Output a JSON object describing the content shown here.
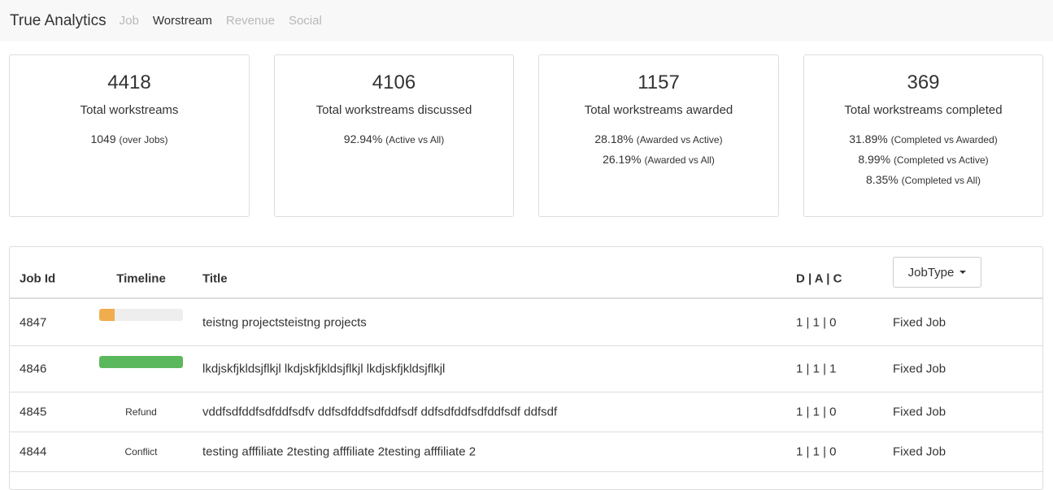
{
  "navbar": {
    "brand": "True Analytics",
    "links": [
      {
        "label": "Job",
        "active": false
      },
      {
        "label": "Worstream",
        "active": true
      },
      {
        "label": "Revenue",
        "active": false
      },
      {
        "label": "Social",
        "active": false
      }
    ]
  },
  "cards": [
    {
      "value": "4418",
      "label": "Total workstreams",
      "stats": [
        {
          "value": "1049",
          "note": "(over Jobs)"
        }
      ]
    },
    {
      "value": "4106",
      "label": "Total workstreams discussed",
      "stats": [
        {
          "value": "92.94%",
          "note": "(Active vs All)"
        }
      ]
    },
    {
      "value": "1157",
      "label": "Total workstreams awarded",
      "stats": [
        {
          "value": "28.18%",
          "note": "(Awarded vs Active)"
        },
        {
          "value": "26.19%",
          "note": "(Awarded vs All)"
        }
      ]
    },
    {
      "value": "369",
      "label": "Total workstreams completed",
      "stats": [
        {
          "value": "31.89%",
          "note": "(Completed vs Awarded)"
        },
        {
          "value": "8.99%",
          "note": "(Completed vs Active)"
        },
        {
          "value": "8.35%",
          "note": "(Completed vs All)"
        }
      ]
    }
  ],
  "table": {
    "headers": {
      "job_id": "Job Id",
      "timeline": "Timeline",
      "title": "Title",
      "dac": "D | A | C",
      "jobtype_button": "JobType"
    },
    "rows": [
      {
        "id": "4847",
        "timeline_progress": 0.18,
        "timeline_color": "#f0ad4e",
        "timeline_text": "",
        "title": "teistng projectsteistng projects",
        "dac": "1 | 1 | 0",
        "type": "Fixed Job"
      },
      {
        "id": "4846",
        "timeline_progress": 1.0,
        "timeline_color": "#5cb85c",
        "timeline_text": "",
        "title": "lkdjskfjkldsjflkjl lkdjskfjkldsjflkjl lkdjskfjkldsjflkjl",
        "dac": "1 | 1 | 1",
        "type": "Fixed Job"
      },
      {
        "id": "4845",
        "timeline_progress": null,
        "timeline_color": "",
        "timeline_text": "Refund",
        "title": "vddfsdfddfsdfddfsdfv ddfsdfddfsdfddfsdf ddfsdfddfsdfddfsdf ddfsdf",
        "dac": "1 | 1 | 0",
        "type": "Fixed Job"
      },
      {
        "id": "4844",
        "timeline_progress": null,
        "timeline_color": "",
        "timeline_text": "Conflict",
        "title": "testing afffiliate 2testing afffiliate 2testing afffiliate 2",
        "dac": "1 | 1 | 0",
        "type": "Fixed Job"
      }
    ]
  }
}
